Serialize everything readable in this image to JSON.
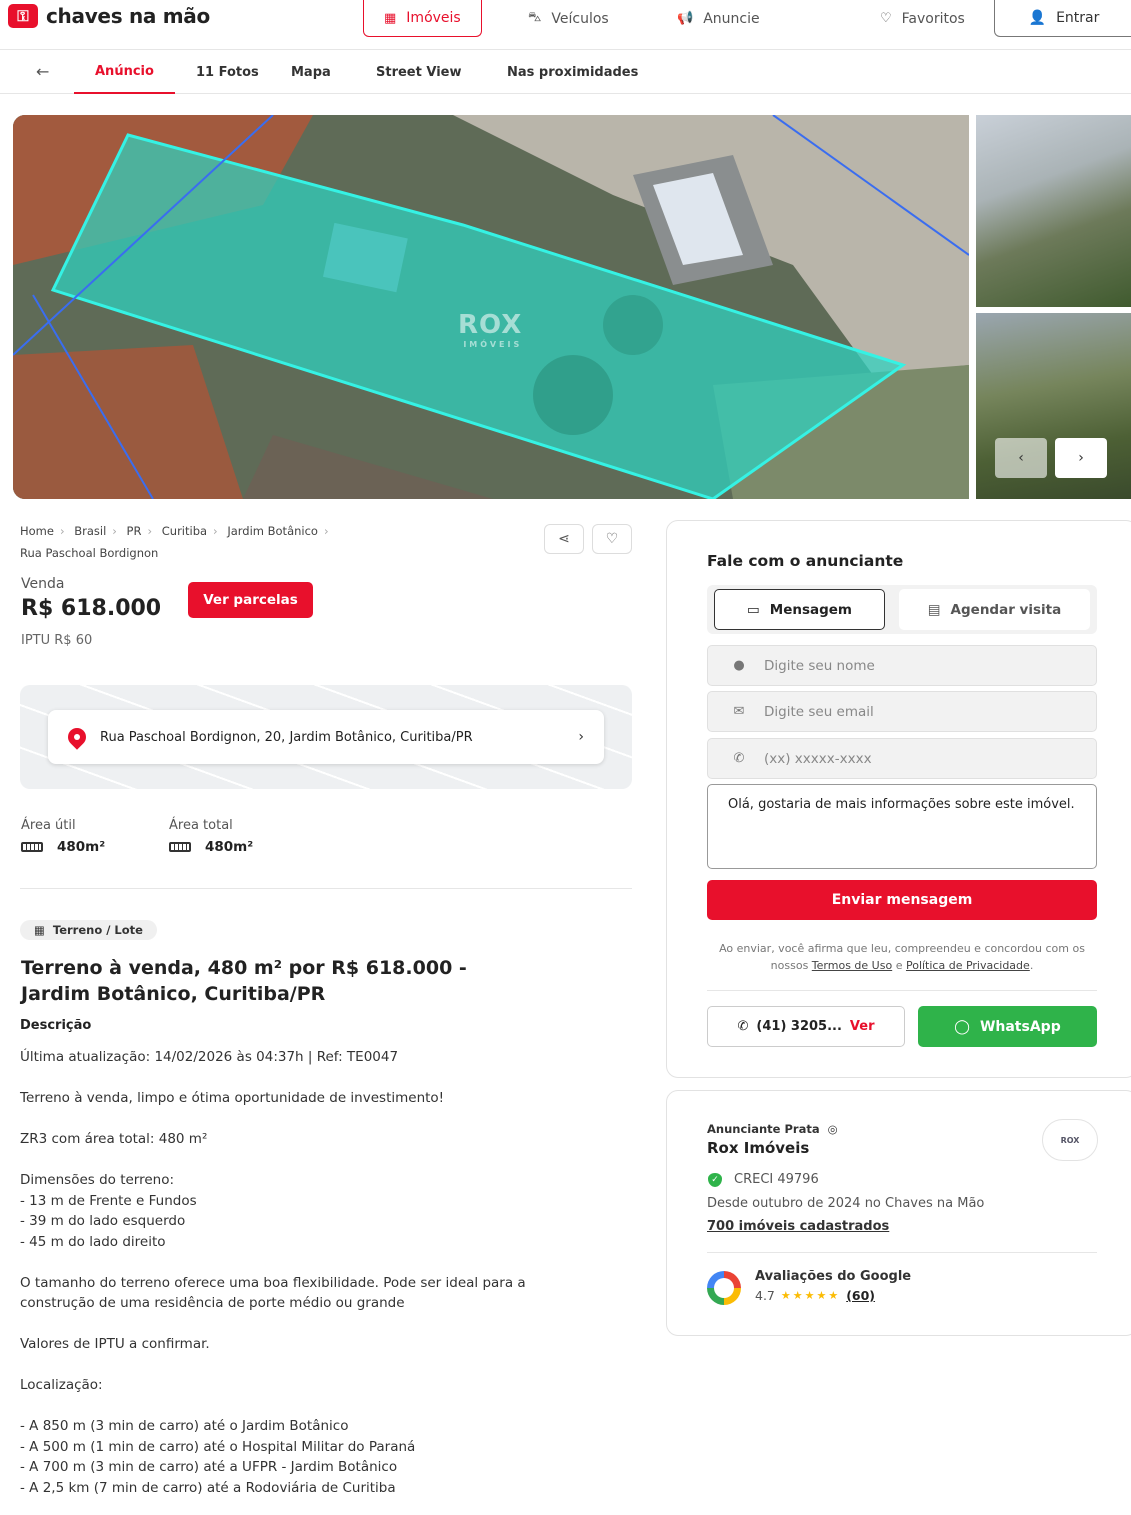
{
  "header": {
    "logo_text": "chaves na mão",
    "nav": [
      {
        "label": "Imóveis",
        "icon": "building-icon"
      },
      {
        "label": "Veículos",
        "icon": "car-icon"
      },
      {
        "label": "Anuncie",
        "icon": "megaphone-icon"
      },
      {
        "label": "Favoritos",
        "icon": "heart-icon"
      }
    ],
    "login_label": "Entrar"
  },
  "subnav": {
    "tabs": [
      "Anúncio",
      "11 Fotos",
      "Mapa",
      "Street View",
      "Nas proximidades"
    ]
  },
  "gallery": {
    "watermark": "ROX",
    "watermark_sub": "IMÓVEIS",
    "photo_count": 11
  },
  "breadcrumb": [
    "Home",
    "Brasil",
    "PR",
    "Curitiba",
    "Jardim Botânico",
    "Rua Paschoal Bordignon"
  ],
  "listing": {
    "deal_type": "Venda",
    "price": "R$ 618.000",
    "installments_label": "Ver parcelas",
    "iptu": "IPTU  R$ 60",
    "address": "Rua Paschoal Bordignon, 20, Jardim Botânico, Curitiba/PR",
    "area_util_label": "Área útil",
    "area_util_value": "480m²",
    "area_total_label": "Área total",
    "area_total_value": "480m²",
    "category": "Terreno / Lote",
    "title": "Terreno à venda, 480 m² por R$ 618.000 - Jardim Botânico, Curitiba/PR",
    "description_heading": "Descrição",
    "description": "Última atualização: 14/02/2026 às 04:37h | Ref: TE0047\n\nTerreno à venda, limpo e ótima oportunidade de investimento!\n\nZR3 com área total: 480 m²\n\nDimensões do terreno:\n- 13 m de Frente e Fundos\n- 39 m do lado esquerdo\n- 45 m do lado direito\n\nO tamanho do terreno oferece uma boa flexibilidade. Pode ser ideal para a construção de uma residência de porte médio ou grande\n\nValores de IPTU a confirmar.\n\nLocalização:\n\n- A 850 m (3 min de carro) até o Jardim Botânico\n- A 500 m (1 min de carro) até o Hospital Militar do Paraná\n- A 700 m (3 min de carro) até a UFPR - Jardim Botânico\n- A 2,5 km (7 min de carro) até a Rodoviária de Curitiba"
  },
  "contact": {
    "title": "Fale com o anunciante",
    "tab_message": "Mensagem",
    "tab_visit": "Agendar visita",
    "name_placeholder": "Digite seu nome",
    "email_placeholder": "Digite seu email",
    "phone_placeholder": "(xx) xxxxx-xxxx",
    "message_value": "Olá, gostaria de mais informações sobre este imóvel.",
    "send_label": "Enviar mensagem",
    "terms_prefix": "Ao enviar, você afirma que leu, compreendeu e concordou com os nossos",
    "terms_link": "Termos de Uso",
    "terms_and": "e",
    "privacy_link": "Política de Privacidade",
    "terms_suffix": ".",
    "phone_partial": "(41) 3205...",
    "phone_reveal": "Ver",
    "whatsapp_label": "WhatsApp"
  },
  "advertiser": {
    "tier": "Anunciante Prata",
    "name": "Rox Imóveis",
    "logo_text": "ROX",
    "creci": "CRECI 49796",
    "since": "Desde outubro de 2024 no Chaves na Mão",
    "listings_link": "700 imóveis cadastrados",
    "google_title": "Avaliações do Google",
    "google_rating": "4.7",
    "google_stars": 4.7,
    "google_count": "(60)"
  },
  "colors": {
    "brand": "#e8102c",
    "whatsapp": "#2fb34a",
    "parcel_overlay": "#2ed3c0"
  }
}
